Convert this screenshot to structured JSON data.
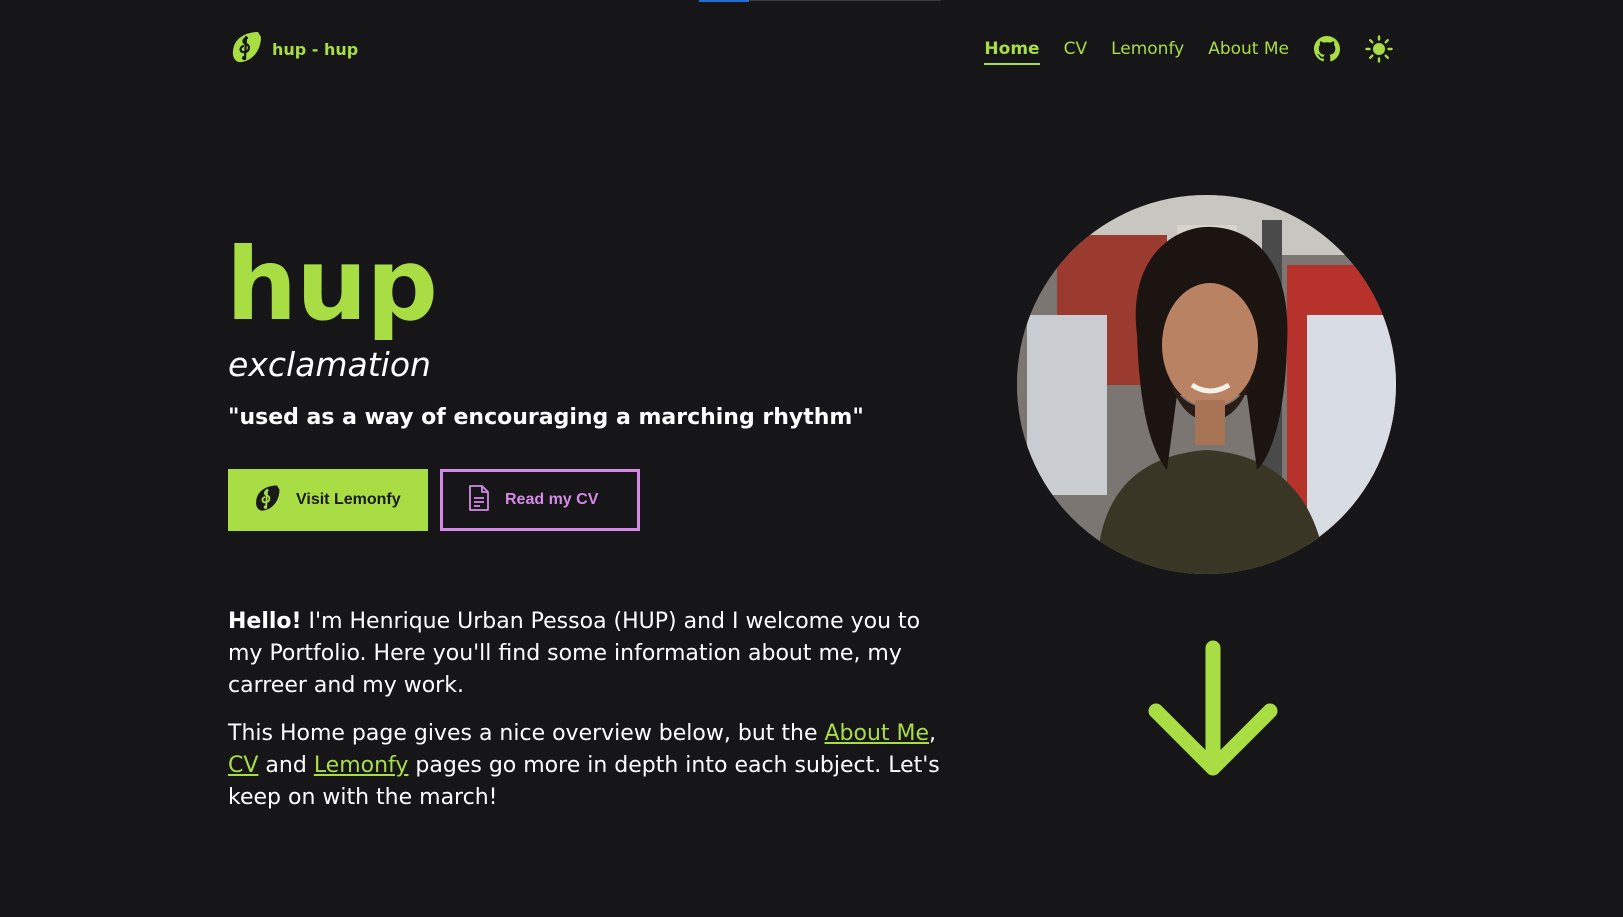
{
  "brand": {
    "name": "hup - hup",
    "logo_icon": "lemon-treble-clef-logo"
  },
  "nav": {
    "items": [
      {
        "label": "Home",
        "active": true
      },
      {
        "label": "CV",
        "active": false
      },
      {
        "label": "Lemonfy",
        "active": false
      },
      {
        "label": "About Me",
        "active": false
      }
    ],
    "github_icon": "github-icon",
    "theme_icon": "sun-icon"
  },
  "hero": {
    "title": "hup",
    "subtitle": "exclamation",
    "quote": "\"used as a way of encouraging a marching rhythm\""
  },
  "buttons": {
    "primary": {
      "label": "Visit Lemonfy",
      "icon": "lemon-treble-clef-logo"
    },
    "secondary": {
      "label": "Read my CV",
      "icon": "document-icon"
    }
  },
  "intro": {
    "p1_bold": "Hello!",
    "p1_rest": " I'm Henrique Urban Pessoa (HUP) and I welcome you to my Portfolio. Here you'll find some information about me, my carreer and my work.",
    "p2_start": "This Home page gives a nice overview below, but the ",
    "p2_link_about": "About Me",
    "p2_comma": ",",
    "p2_link_cv": "CV",
    "p2_and": " and ",
    "p2_link_lemonfy": "Lemonfy",
    "p2_end": " pages go more in depth into each subject. Let's keep on with the march!"
  },
  "scroll_icon": "arrow-down-icon",
  "colors": {
    "background": "#161618",
    "accent": "#a9dd44",
    "secondary_accent": "#d48ae6",
    "text": "#ffffff"
  }
}
